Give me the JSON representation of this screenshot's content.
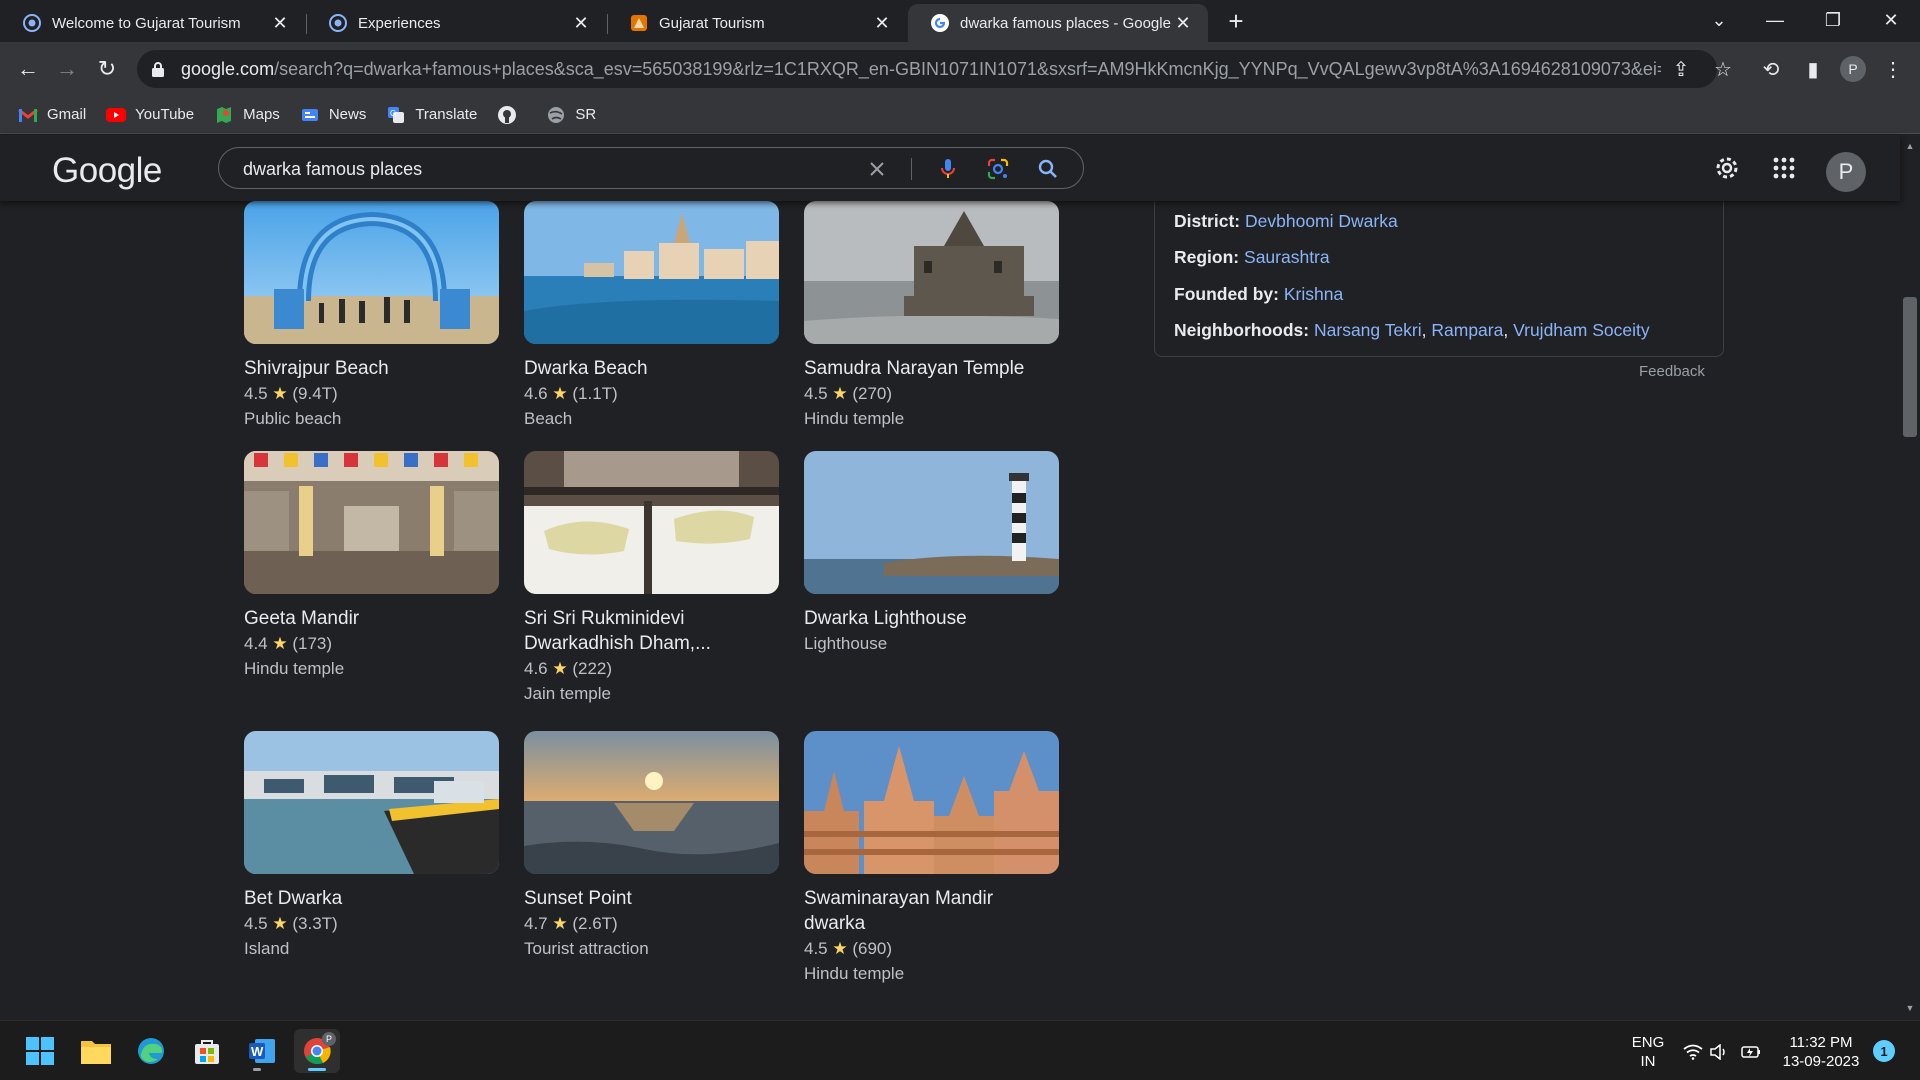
{
  "browser": {
    "tabs": [
      {
        "title": "Welcome to Gujarat Tourism",
        "icon": "gujarat-tourism-favicon"
      },
      {
        "title": "Experiences",
        "icon": "gujarat-tourism-favicon"
      },
      {
        "title": "Gujarat Tourism",
        "icon": "gujarat-tourism-orange-favicon"
      },
      {
        "title": "dwarka famous places - Google S",
        "icon": "google-favicon",
        "active": true
      }
    ],
    "url_host": "google.com",
    "url_path": "/search?q=dwarka+famous+places&sca_esv=565038199&rlz=1C1RXQR_en-GBIN1071IN1071&sxsrf=AM9HkKmcnKjg_YYNPq_VvQALgewv3vp8tA%3A1694628109073&ei=DfkBZb...",
    "profile_initial": "P",
    "bookmarks": [
      {
        "label": "Gmail",
        "icon": "gmail-icon"
      },
      {
        "label": "YouTube",
        "icon": "youtube-icon"
      },
      {
        "label": "Maps",
        "icon": "maps-icon"
      },
      {
        "label": "News",
        "icon": "news-icon"
      },
      {
        "label": "Translate",
        "icon": "translate-icon"
      },
      {
        "label": "",
        "icon": "github-icon"
      },
      {
        "label": "SR",
        "icon": "globe-icon"
      }
    ]
  },
  "google": {
    "logo": "Google",
    "query": "dwarka famous places",
    "avatar_initial": "P"
  },
  "knowledge_panel": {
    "rows": [
      {
        "label": "District:",
        "links": [
          "Devbhoomi Dwarka"
        ]
      },
      {
        "label": "Region:",
        "links": [
          "Saurashtra"
        ]
      },
      {
        "label": "Founded by:",
        "links": [
          "Krishna"
        ]
      },
      {
        "label": "Neighborhoods:",
        "links": [
          "Narsang Tekri",
          "Rampara",
          "Vrujdham Soceity"
        ]
      }
    ],
    "feedback": "Feedback"
  },
  "places": [
    {
      "name": "Shivrajpur Beach",
      "rating": "4.5",
      "reviews": "(9.4T)",
      "type": "Public beach"
    },
    {
      "name": "Dwarka Beach",
      "rating": "4.6",
      "reviews": "(1.1T)",
      "type": "Beach"
    },
    {
      "name": "Samudra Narayan Temple",
      "rating": "4.5",
      "reviews": "(270)",
      "type": "Hindu temple"
    },
    {
      "name": "Geeta Mandir",
      "rating": "4.4",
      "reviews": "(173)",
      "type": "Hindu temple"
    },
    {
      "name": "Sri Sri Rukminidevi Dwarkadhish Dham,...",
      "rating": "4.6",
      "reviews": "(222)",
      "type": "Jain temple"
    },
    {
      "name": "Dwarka Lighthouse",
      "rating": "",
      "reviews": "",
      "type": "Lighthouse"
    },
    {
      "name": "Bet Dwarka",
      "rating": "4.5",
      "reviews": "(3.3T)",
      "type": "Island"
    },
    {
      "name": "Sunset Point",
      "rating": "4.7",
      "reviews": "(2.6T)",
      "type": "Tourist attraction"
    },
    {
      "name": "Swaminarayan Mandir dwarka",
      "rating": "4.5",
      "reviews": "(690)",
      "type": "Hindu temple"
    }
  ],
  "taskbar": {
    "lang_line1": "ENG",
    "lang_line2": "IN",
    "time": "11:32 PM",
    "date": "13-09-2023",
    "notifications": "1",
    "chrome_profile_badge": "P"
  },
  "colors": {
    "link": "#8ab4f8",
    "star": "#fdd663",
    "background": "#202124"
  }
}
